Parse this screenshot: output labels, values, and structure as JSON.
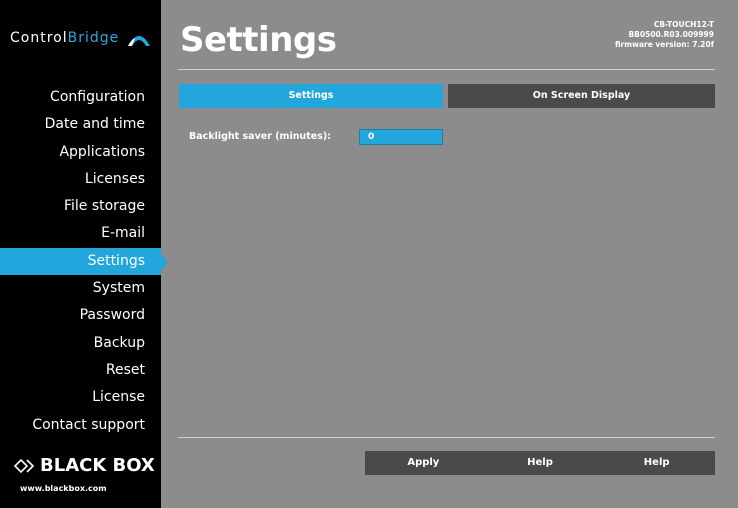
{
  "brand": {
    "logo_part1": "Control",
    "logo_part2": "Bridge",
    "footer_logo": "BLACK BOX",
    "footer_url": "www.blackbox.com",
    "accent_color": "#23a6dc"
  },
  "sidebar": {
    "items": [
      {
        "label": "Configuration",
        "active": false
      },
      {
        "label": "Date and time",
        "active": false
      },
      {
        "label": "Applications",
        "active": false
      },
      {
        "label": "Licenses",
        "active": false
      },
      {
        "label": "File storage",
        "active": false
      },
      {
        "label": "E-mail",
        "active": false
      },
      {
        "label": "Settings",
        "active": true
      },
      {
        "label": "System",
        "active": false
      },
      {
        "label": "Password",
        "active": false
      },
      {
        "label": "Backup",
        "active": false
      },
      {
        "label": "Reset",
        "active": false
      },
      {
        "label": "License",
        "active": false
      },
      {
        "label": "Contact support",
        "active": false
      }
    ]
  },
  "header": {
    "title": "Settings",
    "device_model": "CB-TOUCH12-T",
    "device_serial": "BB0500.R03.009999",
    "firmware": "firmware version: 7.20f"
  },
  "tabs": {
    "settings": "Settings",
    "osd": "On Screen Display"
  },
  "form": {
    "backlight_label": "Backlight saver (minutes):",
    "backlight_value": "0"
  },
  "actions": {
    "apply": "Apply",
    "help1": "Help",
    "help2": "Help"
  }
}
